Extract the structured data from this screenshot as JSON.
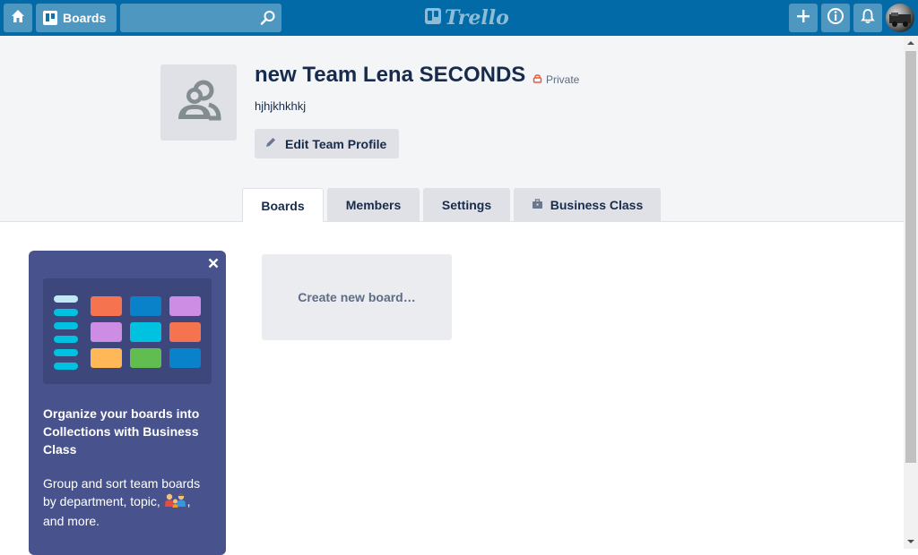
{
  "header": {
    "boards_label": "Boards",
    "search_placeholder": "",
    "logo_text": "Trello",
    "accent_color": "#026aa7"
  },
  "team": {
    "name": "new Team Lena SECONDS",
    "visibility": "Private",
    "description": "hjhjkhkhkj",
    "edit_label": "Edit Team Profile",
    "logo_icon": "team-icon"
  },
  "tabs": [
    {
      "label": "Boards",
      "active": true
    },
    {
      "label": "Members",
      "active": false
    },
    {
      "label": "Settings",
      "active": false
    },
    {
      "label": "Business Class",
      "active": false,
      "icon": "briefcase-icon"
    }
  ],
  "promo": {
    "title": "Organize your boards into Collections with Business Class",
    "body": "Group and sort team boards by department, topic,",
    "body_after_emoji": ", and more.",
    "background_color": "#48538e"
  },
  "boards": {
    "create_label": "Create new board…"
  }
}
